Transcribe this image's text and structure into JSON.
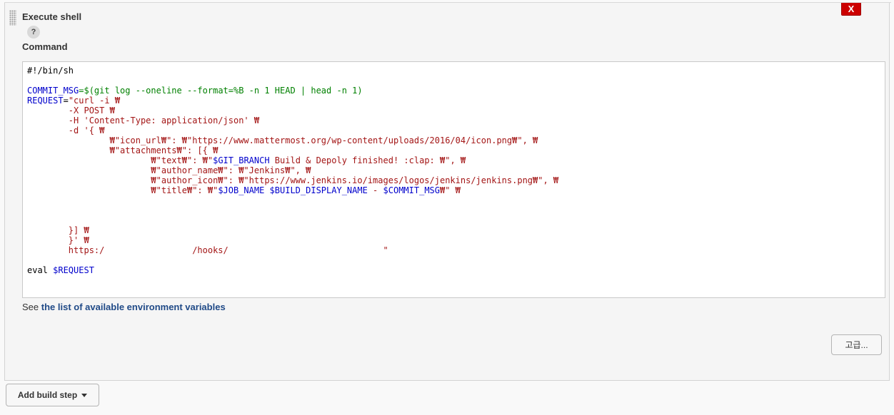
{
  "build_step": {
    "title": "Execute shell",
    "delete_label": "X",
    "help_label": "?",
    "command_label": "Command",
    "script_lines": [
      [
        {
          "t": "#!/bin/sh"
        }
      ],
      [],
      [
        {
          "t": "COMMIT_MSG",
          "c": "var"
        },
        {
          "t": "=$(git log --oneline --format=%B -n 1 HEAD | head -n 1)",
          "c": "sub"
        }
      ],
      [
        {
          "t": "REQUEST",
          "c": "var"
        },
        {
          "t": "="
        },
        {
          "t": "\"curl -i ₩",
          "c": "str"
        }
      ],
      [
        {
          "t": "        -X POST ₩",
          "c": "str"
        }
      ],
      [
        {
          "t": "        -H 'Content-Type: application/json' ₩",
          "c": "str"
        }
      ],
      [
        {
          "t": "        -d '{ ₩",
          "c": "str"
        }
      ],
      [
        {
          "t": "                ₩\"icon_url₩\": ₩\"https://www.mattermost.org/wp-content/uploads/2016/04/icon.png₩\", ₩",
          "c": "str"
        }
      ],
      [
        {
          "t": "                ₩\"attachments₩\": [{ ₩",
          "c": "str"
        }
      ],
      [
        {
          "t": "                        ₩\"text₩\": ₩\"",
          "c": "str"
        },
        {
          "t": "$GIT_BRANCH",
          "c": "var"
        },
        {
          "t": " Build & Depoly finished! :clap: ₩\", ₩",
          "c": "str"
        }
      ],
      [
        {
          "t": "                        ₩\"author_name₩\": ₩\"Jenkins₩\", ₩",
          "c": "str"
        }
      ],
      [
        {
          "t": "                        ₩\"author_icon₩\": ₩\"https://www.jenkins.io/images/logos/jenkins/jenkins.png₩\", ₩",
          "c": "str"
        }
      ],
      [
        {
          "t": "                        ₩\"title₩\": ₩\"",
          "c": "str"
        },
        {
          "t": "$JOB_NAME $BUILD_DISPLAY_NAME",
          "c": "var"
        },
        {
          "t": " - ",
          "c": "str"
        },
        {
          "t": "$COMMIT_MSG",
          "c": "var"
        },
        {
          "t": "₩\" ₩",
          "c": "str"
        }
      ],
      [],
      [],
      [],
      [
        {
          "t": "        }] ₩",
          "c": "str"
        }
      ],
      [
        {
          "t": "        }' ₩",
          "c": "str"
        }
      ],
      [
        {
          "t": "        https:/                 /hooks/                              \"",
          "c": "str"
        }
      ],
      [],
      [
        {
          "t": "eval "
        },
        {
          "t": "$REQUEST",
          "c": "var"
        }
      ]
    ],
    "env_help_prefix": "See ",
    "env_help_link": "the list of available environment variables",
    "advanced_label": "고급..."
  },
  "add_build_step_label": "Add build step",
  "colors": {
    "delete_button": "#cc0000",
    "link": "#204a87",
    "variable": "#0000cc",
    "string": "#a31515",
    "substitution": "#008000"
  }
}
